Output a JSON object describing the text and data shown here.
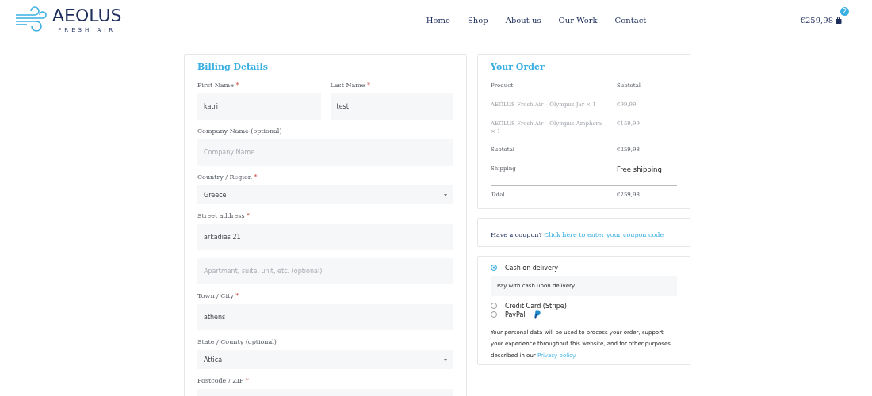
{
  "header": {
    "logo": {
      "name": "AEOLUS",
      "tagline": "FRESH AIR"
    },
    "nav": [
      {
        "label": "Home"
      },
      {
        "label": "Shop"
      },
      {
        "label": "About us"
      },
      {
        "label": "Our Work"
      },
      {
        "label": "Contact"
      }
    ],
    "cart": {
      "total": "€259,98",
      "count": "2"
    }
  },
  "billing": {
    "title": "Billing Details",
    "rows": [
      [
        {
          "label": "First Name",
          "mark": "*",
          "kind": "text",
          "value": "katri"
        },
        {
          "label": "Last Name",
          "mark": "*",
          "kind": "text",
          "value": "test"
        }
      ],
      [
        {
          "label": "Company Name (optional)",
          "kind": "text",
          "placeholder": "Company Name"
        }
      ],
      [
        {
          "label": "Country / Region",
          "mark": "*",
          "kind": "select",
          "value": "Greece"
        }
      ],
      [
        {
          "label": "Street address",
          "mark": "*",
          "kind": "text",
          "value": "arkadias 21"
        }
      ],
      [
        {
          "kind": "text",
          "placeholder": "Apartment, suite, unit, etc. (optional)"
        }
      ],
      [
        {
          "label": "Town / City",
          "mark": "*",
          "kind": "text",
          "value": "athens"
        }
      ],
      [
        {
          "label": "State / County (optional)",
          "kind": "select",
          "value": "Attica"
        }
      ],
      [
        {
          "label": "Postcode / ZIP",
          "mark": "*",
          "kind": "text"
        }
      ]
    ]
  },
  "order": {
    "title": "Your Order",
    "columns": [
      "Product",
      "Subtotal"
    ],
    "items": [
      {
        "name": "AEOLUS Fresh Air – Olympus Jar",
        "qty": "× 1",
        "price": "€99,99"
      },
      {
        "name": "AEOLUS Fresh Air – Olympus Amphora",
        "qty": "× 1",
        "price": "€159,99"
      }
    ],
    "subtotal": {
      "label": "Subtotal",
      "value": "€259,98"
    },
    "shipping": {
      "label": "Shipping",
      "value": "Free shipping"
    },
    "total": {
      "label": "Total",
      "value": "€259,98"
    }
  },
  "coupon": {
    "text": "Have a coupon?",
    "link": "Click here to enter your coupon code"
  },
  "payment": {
    "methods": [
      {
        "label": "Cash on delivery",
        "selected": true,
        "description": "Pay with cash upon delivery."
      },
      {
        "label": "Credit Card (Stripe)",
        "selected": false
      },
      {
        "label": "PayPal",
        "selected": false,
        "kind": "paypal"
      }
    ],
    "privacy": {
      "text": "Your personal data will be used to process your order, support your experience throughout this website, and for other purposes described in our ",
      "link": "Privacy policy",
      "end": "."
    }
  }
}
